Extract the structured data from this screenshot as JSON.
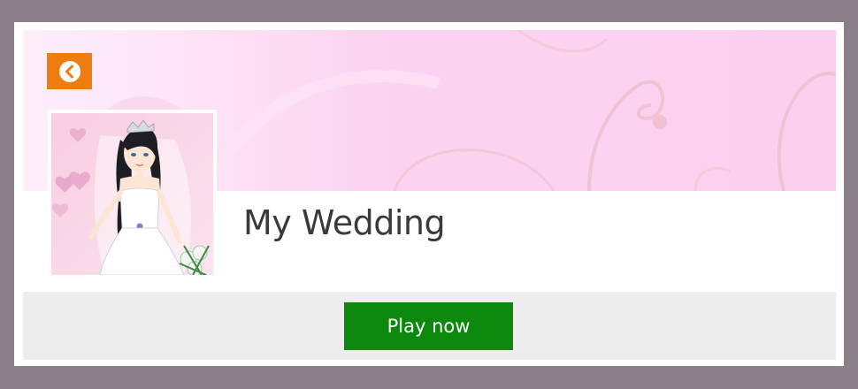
{
  "game": {
    "title": "My Wedding",
    "play_label": "Play now"
  },
  "icons": {
    "back": "chevron-left-circle-icon"
  },
  "colors": {
    "page_background": "#8a7f86",
    "banner_pink": "#fbd0ef",
    "back_button": "#ee7d0f",
    "play_button": "#0c890c",
    "footer_bar": "#ededed"
  }
}
